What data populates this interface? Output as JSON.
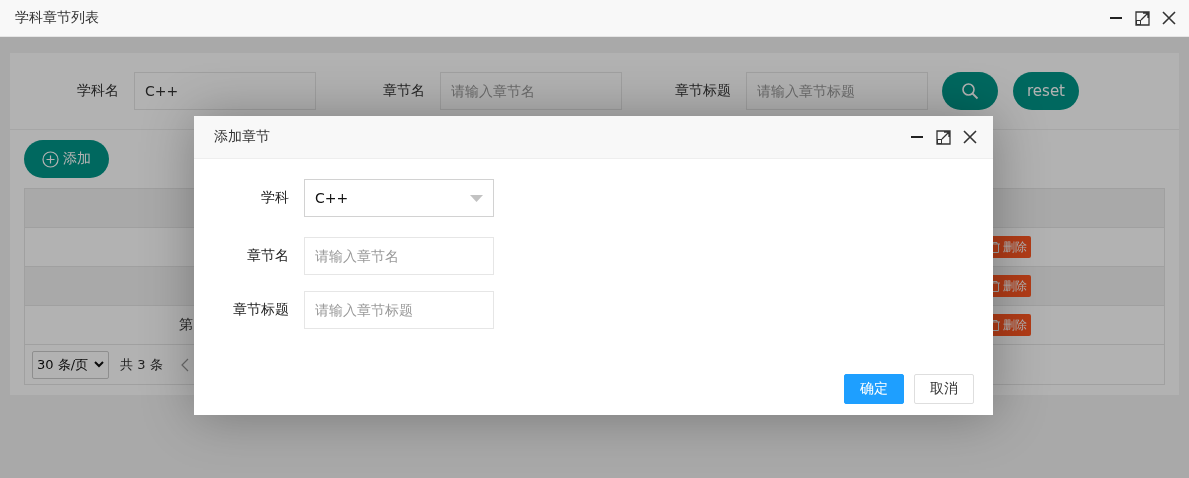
{
  "window": {
    "title": "学科章节列表"
  },
  "search_form": {
    "fields": [
      {
        "label": "学科名",
        "value": "C++"
      },
      {
        "label": "章节名",
        "placeholder": "请输入章节名"
      },
      {
        "label": "章节标题",
        "placeholder": "请输入章节标题"
      }
    ],
    "reset_button": "reset"
  },
  "add_button": "添加",
  "table": {
    "rows": [
      {
        "delete_button": "删除"
      },
      {
        "delete_button": "删除"
      },
      {
        "column_1": "第",
        "delete_button": "删除"
      }
    ]
  },
  "pager": {
    "page_size": "30 条/页",
    "total": "共 3 条"
  },
  "dialog": {
    "title": "添加章节",
    "fields": [
      {
        "kind": "select",
        "label": "学科",
        "value": "C++"
      },
      {
        "kind": "input",
        "label": "章节名",
        "placeholder": "请输入章节名"
      },
      {
        "kind": "input",
        "label": "章节标题",
        "placeholder": "请输入章节标题"
      }
    ],
    "buttons": [
      {
        "kind": "primary",
        "label": "确定"
      },
      {
        "kind": "default",
        "label": "取消"
      }
    ]
  }
}
